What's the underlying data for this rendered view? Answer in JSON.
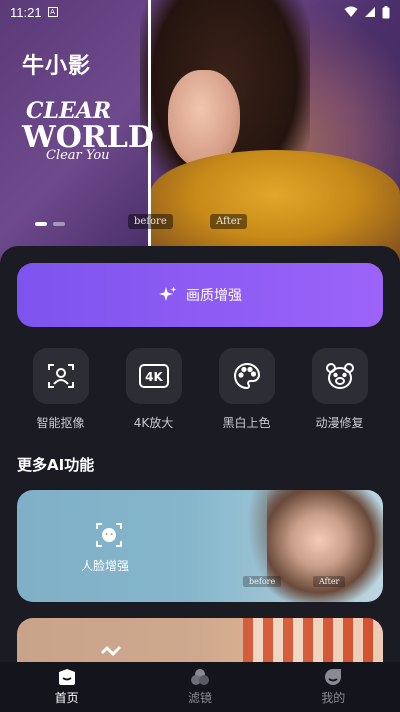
{
  "status_bar": {
    "time": "11:21",
    "sim_letter": "A"
  },
  "hero": {
    "app_name": "牛小影",
    "tagline_line1": "CLEAR",
    "tagline_line2": "WORLD",
    "tagline_script": "Clear You",
    "before_label": "before",
    "after_label": "After"
  },
  "primary_action": {
    "label": "画质增强"
  },
  "tools": [
    {
      "label": "智能抠像",
      "icon": "portrait-cutout-icon"
    },
    {
      "label": "4K放大",
      "icon": "4k-icon"
    },
    {
      "label": "黑白上色",
      "icon": "palette-icon"
    },
    {
      "label": "动漫修复",
      "icon": "bear-face-icon"
    }
  ],
  "more_section": {
    "title": "更多AI功能",
    "cards": [
      {
        "label": "人脸增强",
        "before_label": "before",
        "after_label": "After"
      }
    ]
  },
  "bottom_nav": [
    {
      "label": "首页",
      "icon": "home-icon",
      "active": true
    },
    {
      "label": "滤镜",
      "icon": "filter-icon",
      "active": false
    },
    {
      "label": "我的",
      "icon": "profile-icon",
      "active": false
    }
  ],
  "colors": {
    "accent_gradient_start": "#7d54ee",
    "accent_gradient_end": "#9c63f8",
    "background": "#14141c",
    "sheet": "#1b1b24",
    "tile": "#2d2d36"
  }
}
